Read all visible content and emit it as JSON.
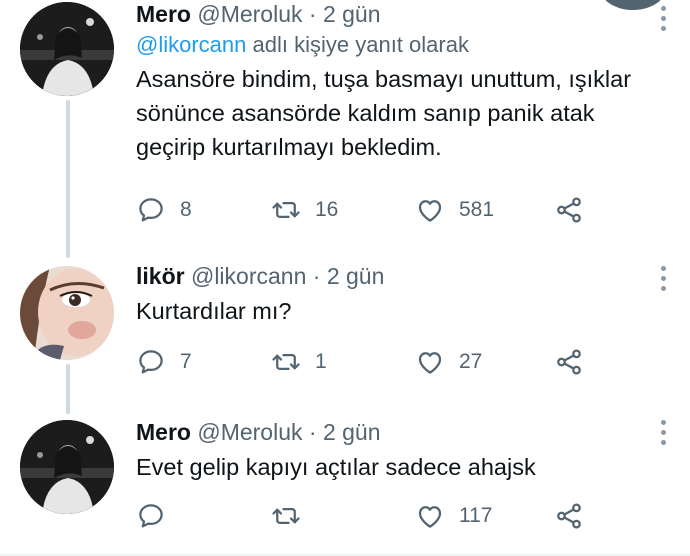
{
  "tweets": [
    {
      "name": "Mero",
      "handle": "@Meroluk",
      "separator": "·",
      "time": "2 gün",
      "reply_to_handle": "@likorcann",
      "reply_to_suffix": "adlı kişiye yanıt olarak",
      "text": "Asansöre bindim, tuşa basmayı unuttum, ışıklar sönünce asansörde kaldım sanıp panik atak geçirip kurtarılmayı bekledim.",
      "replies": "8",
      "retweets": "16",
      "likes": "581"
    },
    {
      "name": "likör",
      "handle": "@likorcann",
      "separator": "·",
      "time": "2 gün",
      "text": "Kurtardılar mı?",
      "replies": "7",
      "retweets": "1",
      "likes": "27"
    },
    {
      "name": "Mero",
      "handle": "@Meroluk",
      "separator": "·",
      "time": "2 gün",
      "text": "Evet gelip kapıyı açtılar sadece ahajsk",
      "replies": "",
      "retweets": "",
      "likes": "117"
    }
  ],
  "icons": {
    "reply": "comment-icon",
    "retweet": "retweet-icon",
    "like": "heart-icon",
    "share": "share-icon",
    "more": "more-vertical-icon"
  },
  "colors": {
    "link": "#1d9bf0",
    "muted": "#536471",
    "text": "#0f1419",
    "thread_line": "#cfd9de"
  }
}
